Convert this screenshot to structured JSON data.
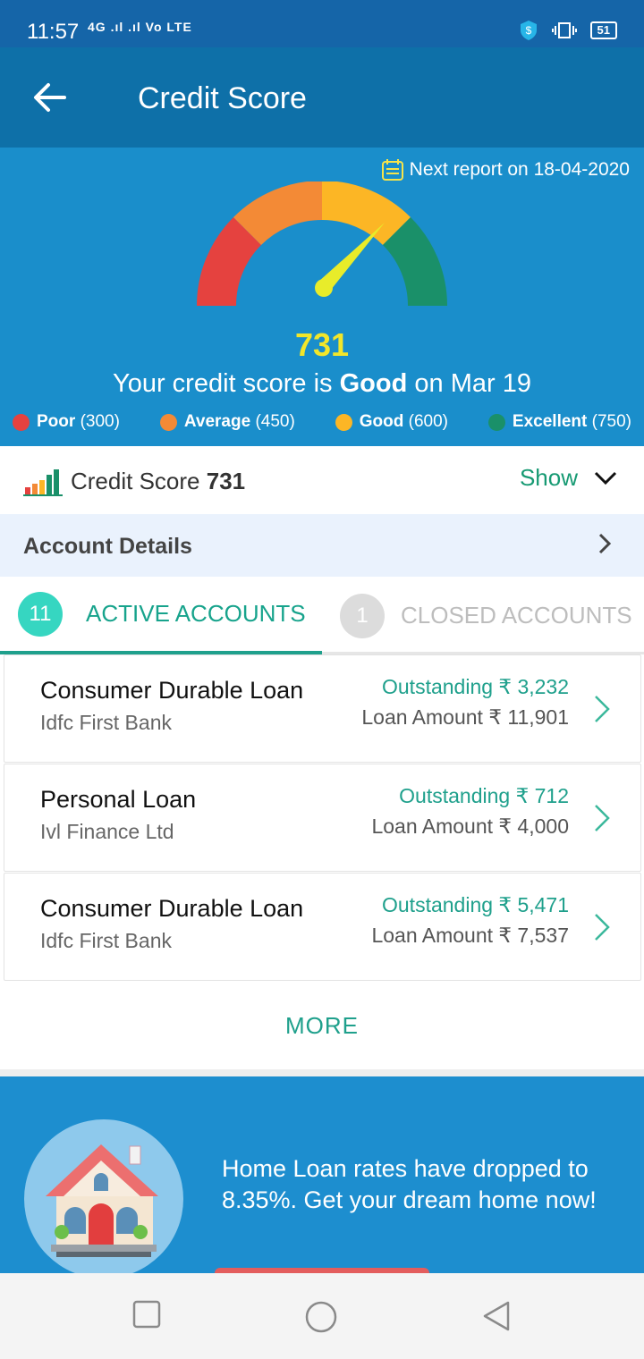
{
  "status_bar": {
    "time": "11:57",
    "network": "4G .ıl .ıl Vo LTE",
    "battery": "51"
  },
  "app_bar": {
    "title": "Credit Score"
  },
  "hero": {
    "next_report": "Next report on 18-04-2020",
    "score": "731",
    "score_prefix": "Your credit score is ",
    "score_rating": "Good",
    "score_suffix": " on Mar 19",
    "legend": [
      {
        "label": "Poor",
        "value": "(300)",
        "color": "#e5423f"
      },
      {
        "label": "Average",
        "value": "(450)",
        "color": "#f38a36"
      },
      {
        "label": "Good",
        "value": "(600)",
        "color": "#fcb625"
      },
      {
        "label": "Excellent",
        "value": "(750)",
        "color": "#1a9069"
      }
    ]
  },
  "score_row": {
    "label": "Credit Score",
    "value": "731",
    "show": "Show"
  },
  "account_details": {
    "label": "Account Details"
  },
  "tabs": {
    "active": {
      "count": "11",
      "label": "ACTIVE ACCOUNTS"
    },
    "closed": {
      "count": "1",
      "label": "CLOSED ACCOUNTS"
    }
  },
  "accounts": [
    {
      "title": "Consumer Durable Loan",
      "bank": "Idfc First Bank",
      "outstanding": "Outstanding ₹ 3,232",
      "loan_amount": "Loan Amount ₹ 11,901"
    },
    {
      "title": "Personal Loan",
      "bank": "Ivl Finance Ltd",
      "outstanding": "Outstanding ₹ 712",
      "loan_amount": "Loan Amount ₹ 4,000"
    },
    {
      "title": "Consumer Durable Loan",
      "bank": "Idfc First Bank",
      "outstanding": "Outstanding ₹ 5,471",
      "loan_amount": "Loan Amount ₹ 7,537"
    }
  ],
  "more": "MORE",
  "promo": {
    "text": "Home Loan rates have dropped to 8.35%. Get your dream home now!"
  },
  "colors": {
    "accent": "#1fa08c",
    "header": "#0e70a8",
    "hero": "#1a8ecb",
    "score": "#f2e62a"
  },
  "icons": [
    "back-arrow-icon",
    "calendar-icon",
    "bar-chart-icon",
    "chevron-down-icon",
    "chevron-right-icon",
    "house-icon",
    "square-icon",
    "circle-icon",
    "triangle-back-icon"
  ]
}
